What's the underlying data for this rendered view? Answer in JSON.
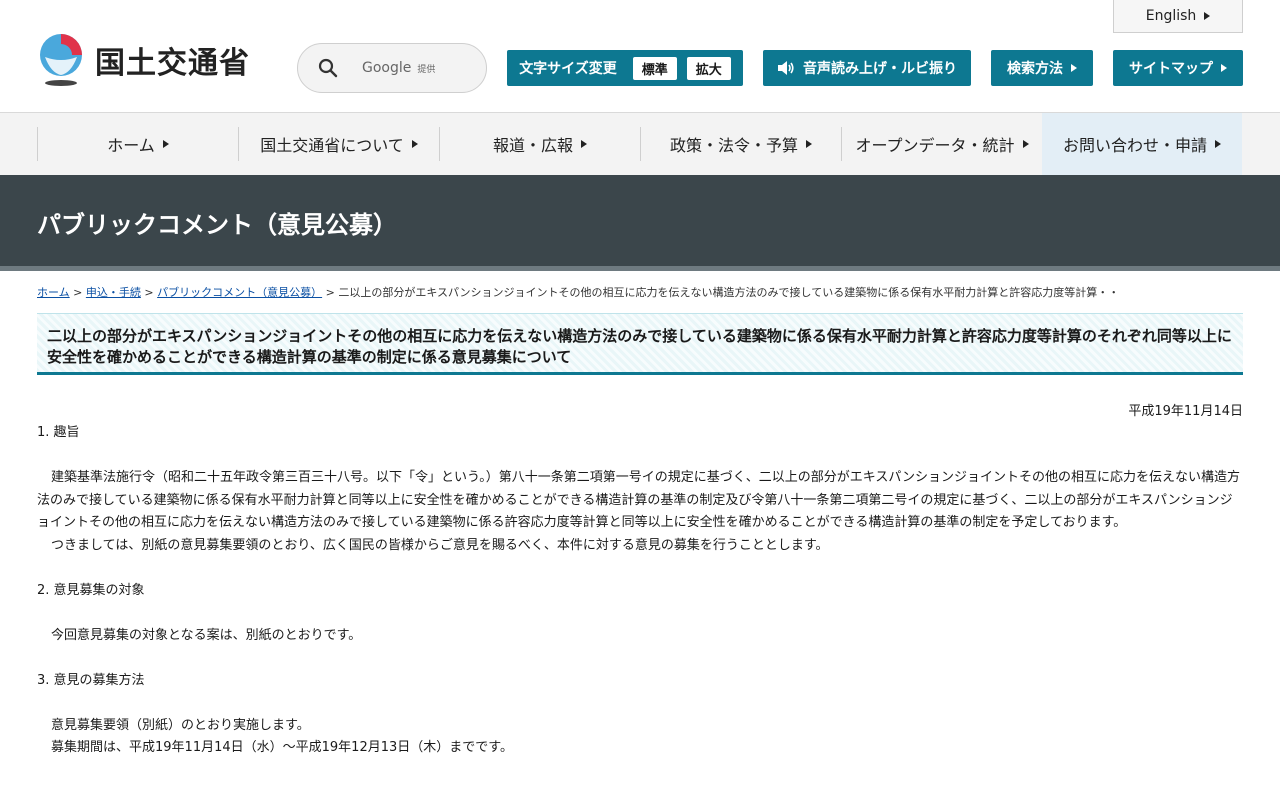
{
  "header": {
    "logo_text": "国土交通省",
    "search": {
      "brand": "Google",
      "provided": "提供"
    },
    "english_label": "English",
    "font_size": {
      "label": "文字サイズ変更",
      "standard": "標準",
      "large": "拡大"
    },
    "audio_label": "音声読み上げ・ルビ振り",
    "search_method_label": "検索方法",
    "sitemap_label": "サイトマップ"
  },
  "nav": {
    "items": [
      "ホーム",
      "国土交通省について",
      "報道・広報",
      "政策・法令・予算",
      "オープンデータ・統計",
      "お問い合わせ・申請"
    ]
  },
  "banner": {
    "title": "パブリックコメント（意見公募）"
  },
  "breadcrumb": {
    "links": [
      "ホーム",
      "申込・手続",
      "パブリックコメント（意見公募）"
    ],
    "current": "二以上の部分がエキスパンションジョイントその他の相互に応力を伝えない構造方法のみで接している建築物に係る保有水平耐力計算と許容応力度等計算・・"
  },
  "page": {
    "heading": "二以上の部分がエキスパンションジョイントその他の相互に応力を伝えない構造方法のみで接している建築物に係る保有水平耐力計算と許容応力度等計算のそれぞれ同等以上に安全性を確かめることができる構造計算の基準の制定に係る意見募集について",
    "date": "平成19年11月14日",
    "sections": [
      {
        "title": "1. 趣旨",
        "paragraphs": [
          "建築基準法施行令（昭和二十五年政令第三百三十八号。以下「令」という。）第八十一条第二項第一号イの規定に基づく、二以上の部分がエキスパンションジョイントその他の相互に応力を伝えない構造方法のみで接している建築物に係る保有水平耐力計算と同等以上に安全性を確かめることができる構造計算の基準の制定及び令第八十一条第二項第二号イの規定に基づく、二以上の部分がエキスパンションジョイントその他の相互に応力を伝えない構造方法のみで接している建築物に係る許容応力度等計算と同等以上に安全性を確かめることができる構造計算の基準の制定を予定しております。",
          "つきましては、別紙の意見募集要領のとおり、広く国民の皆様からご意見を賜るべく、本件に対する意見の募集を行うこととします。"
        ]
      },
      {
        "title": "2. 意見募集の対象",
        "paragraphs": [
          "今回意見募集の対象となる案は、別紙のとおりです。"
        ]
      },
      {
        "title": "3. 意見の募集方法",
        "paragraphs": [
          "意見募集要領（別紙）のとおり実施します。",
          "募集期間は、平成19年11月14日（水）～平成19年12月13日（木）までです。"
        ]
      }
    ]
  },
  "colors": {
    "accent": "#0d7891",
    "banner": "#3b464b",
    "link": "#0a4fa3"
  }
}
